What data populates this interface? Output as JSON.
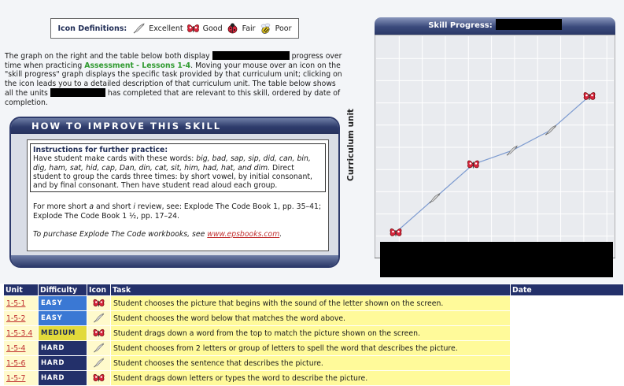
{
  "legend": {
    "title": "Icon Definitions:",
    "items": [
      {
        "label": "Excellent",
        "icon": "feather-icon"
      },
      {
        "label": "Good",
        "icon": "butterfly-icon"
      },
      {
        "label": "Fair",
        "icon": "ladybug-icon"
      },
      {
        "label": "Poor",
        "icon": "bee-icon"
      }
    ]
  },
  "intro": {
    "p1": "The graph on the right and the table below both display",
    "p2": "progress over time when practicing",
    "assessment": "Assessment - Lessons 1-4",
    "p3": ". Moving your mouse over an icon on the \"skill progress\" graph displays the specific task provided by that curriculum unit; clicking on the icon leads you to a detailed description of that curriculum unit. The table below shows all the units",
    "p4": "has completed that are relevant to this skill, ordered by date of completion."
  },
  "improve": {
    "title": "HOW TO IMPROVE THIS SKILL",
    "instructions_title": "Instructions for further practice:",
    "instructions_text_a": "Have student make cards with these words: ",
    "instructions_words": "big, bad, sap, sip, did, can, bin, dig, ham, sat, hid, cap, Dan, din, cat, sit, him, had, hat, and dim.",
    "instructions_text_b": " Direct student to group the cards three times: by short vowel, by initial consonant, and by final consonant. Then have student read aloud each group.",
    "more_a": "For more short ",
    "more_a_letter": "a",
    "more_b": " and short ",
    "more_i_letter": "i",
    "more_c": " review, see: Explode The Code Book 1, pp. 35–41; Explode The Code Book 1 ½, pp. 17–24.",
    "purchase_text": "To purchase Explode The Code workbooks, see ",
    "purchase_link": "www.epsbooks.com",
    "purchase_end": "."
  },
  "chart": {
    "title": "Skill Progress:",
    "ylabel": "Curriculum unit"
  },
  "chart_data": {
    "type": "line",
    "title": "Skill Progress:",
    "ylabel": "Curriculum unit",
    "xlabel": "",
    "x": [
      1,
      2,
      3,
      4,
      5,
      6
    ],
    "series": [
      {
        "values": [
          1,
          2,
          3,
          3.4,
          4,
          5
        ],
        "icons": [
          "butterfly-icon",
          "feather-icon",
          "butterfly-icon",
          "feather-icon",
          "feather-icon",
          "butterfly-icon"
        ]
      }
    ],
    "grid": true,
    "color": "#7d9bd0"
  },
  "table": {
    "headers": [
      "Unit",
      "Difficulty",
      "Icon",
      "Task",
      "Date"
    ],
    "rows": [
      {
        "unit": "1-5-1",
        "difficulty": "Easy",
        "level": "easy",
        "icon": "butterfly-icon",
        "task": "Student chooses the picture that begins with the sound of the letter shown on the screen."
      },
      {
        "unit": "1-5-2",
        "difficulty": "Easy",
        "level": "easy",
        "icon": "feather-icon",
        "task": "Student chooses the word below that matches the word above."
      },
      {
        "unit": "1-5-3.4",
        "difficulty": "Medium",
        "level": "medium",
        "icon": "butterfly-icon",
        "task": "Student drags down a word from the top to match the picture shown on the screen."
      },
      {
        "unit": "1-5-4",
        "difficulty": "Hard",
        "level": "hard",
        "icon": "feather-icon",
        "task": "Student chooses from 2 letters or group of letters to spell the word that describes the picture."
      },
      {
        "unit": "1-5-6",
        "difficulty": "Hard",
        "level": "hard",
        "icon": "feather-icon",
        "task": "Student chooses the sentence that describes the picture."
      },
      {
        "unit": "1-5-7",
        "difficulty": "Hard",
        "level": "hard",
        "icon": "butterfly-icon",
        "task": "Student drags down letters or types the word to describe the picture."
      }
    ]
  }
}
